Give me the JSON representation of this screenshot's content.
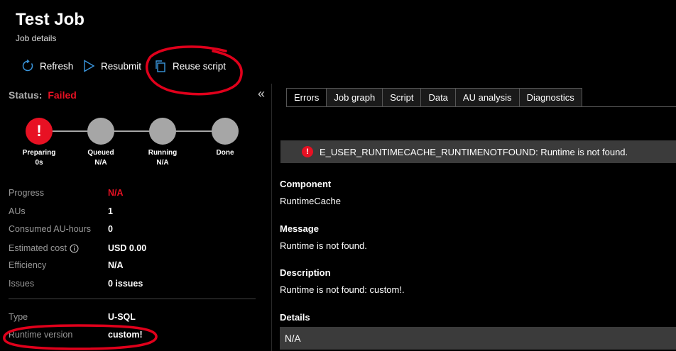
{
  "header": {
    "title": "Test Job",
    "subtitle": "Job details"
  },
  "toolbar": {
    "refresh_label": "Refresh",
    "resubmit_label": "Resubmit",
    "reuse_label": "Reuse script"
  },
  "status": {
    "label": "Status:",
    "value": "Failed"
  },
  "steps": [
    {
      "name": "Preparing",
      "time": "0s",
      "state": "error"
    },
    {
      "name": "Queued",
      "time": "N/A",
      "state": "pending"
    },
    {
      "name": "Running",
      "time": "N/A",
      "state": "pending"
    },
    {
      "name": "Done",
      "time": "",
      "state": "pending"
    }
  ],
  "error_glyph": "!",
  "metrics": [
    {
      "label": "Progress",
      "value": "N/A"
    },
    {
      "label": "AUs",
      "value": "1"
    },
    {
      "label": "Consumed AU-hours",
      "value": "0"
    },
    {
      "label": "Estimated cost",
      "value": "USD 0.00"
    },
    {
      "label": "Efficiency",
      "value": "N/A"
    },
    {
      "label": "Issues",
      "value": "0 issues"
    }
  ],
  "info": [
    {
      "label": "Type",
      "value": "U-SQL"
    },
    {
      "label": "Runtime version",
      "value": "custom!"
    }
  ],
  "tabs": [
    "Errors",
    "Job graph",
    "Script",
    "Data",
    "AU analysis",
    "Diagnostics"
  ],
  "error": {
    "message": "E_USER_RUNTIMECACHE_RUNTIMENOTFOUND: Runtime is not found."
  },
  "sections": {
    "component_head": "Component",
    "component_body": "RuntimeCache",
    "message_head": "Message",
    "message_body": "Runtime is not found.",
    "description_head": "Description",
    "description_body": "Runtime is not found: custom!.",
    "details_head": "Details",
    "details_body": "N/A"
  },
  "colors": {
    "error": "#e81123",
    "accent": "#3a96dd",
    "annotation": "#e0001b"
  },
  "icons": [
    "refresh-icon",
    "resubmit-icon",
    "copy-icon",
    "collapse-icon",
    "info-icon",
    "error-icon"
  ]
}
